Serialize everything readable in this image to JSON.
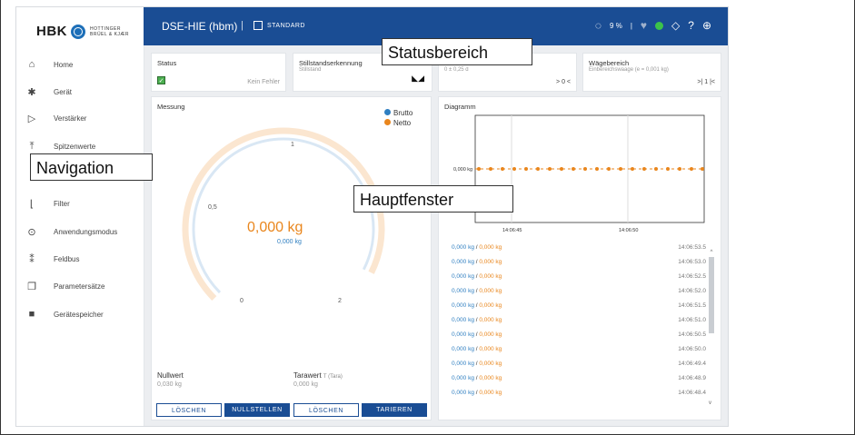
{
  "logo": {
    "brand": "HBK",
    "sub1": "HOTTINGER",
    "sub2": "BRÜEL & KJÆR"
  },
  "nav": [
    {
      "label": "Home",
      "icon": "home-icon"
    },
    {
      "label": "Gerät",
      "icon": "gear-icon"
    },
    {
      "label": "Verstärker",
      "icon": "amplifier-icon"
    },
    {
      "label": "Spitzenwerte",
      "icon": "peak-icon"
    },
    {
      "label": "Filter",
      "icon": "filter-icon"
    },
    {
      "label": "Anwendungsmodus",
      "icon": "mode-icon"
    },
    {
      "label": "Feldbus",
      "icon": "fieldbus-icon"
    },
    {
      "label": "Parametersätze",
      "icon": "parameter-sets-icon"
    },
    {
      "label": "Gerätespeicher",
      "icon": "folder-icon"
    }
  ],
  "topbar": {
    "title": "DSE-HIE (hbm)",
    "separator": "|",
    "mode": "STANDARD",
    "percent": "9 %",
    "separator2": "|"
  },
  "status_cards": {
    "status": {
      "title": "Status",
      "value": "Kein Fehler"
    },
    "still": {
      "title": "Stillstandserkennung",
      "sub": "Stillstand"
    },
    "zero": {
      "sub": "0 ± 0,25 d",
      "value": "> 0 <"
    },
    "range": {
      "title": "Wägebereich",
      "sub": "Einbereichswaage (e = 0,001 kg)",
      "value": ">| 1 |<"
    }
  },
  "measure": {
    "title": "Messung",
    "legend": [
      {
        "label": "Brutto",
        "color": "#2f7fc1"
      },
      {
        "label": "Netto",
        "color": "#e9861d"
      }
    ],
    "value_main": "0,000 kg",
    "value_sub": "0,000 kg",
    "gauge_fraction": 0.0,
    "ticks": {
      "t0": "0",
      "t05": "0,5",
      "t1": "1",
      "t2": "2"
    },
    "nullwert_label": "Nullwert",
    "nullwert_value": "0,030 kg",
    "tara_label": "Tarawert",
    "tara_hint": "T (Tara)",
    "tara_value": "0,000 kg",
    "buttons": [
      "LÖSCHEN",
      "NULLSTELLEN",
      "LÖSCHEN",
      "TARIEREN"
    ]
  },
  "diagram": {
    "title": "Diagramm",
    "ylabel": "0,000 kg",
    "xticks": [
      "14:06:45",
      "14:06:50"
    ]
  },
  "log": [
    {
      "b": "0,000 kg",
      "o": "0,000 kg",
      "t": "14:06:53.5"
    },
    {
      "b": "0,000 kg",
      "o": "0,000 kg",
      "t": "14:06:53.0"
    },
    {
      "b": "0,000 kg",
      "o": "0,000 kg",
      "t": "14:06:52.5"
    },
    {
      "b": "0,000 kg",
      "o": "0,000 kg",
      "t": "14:06:52.0"
    },
    {
      "b": "0,000 kg",
      "o": "0,000 kg",
      "t": "14:06:51.5"
    },
    {
      "b": "0,000 kg",
      "o": "0,000 kg",
      "t": "14:06:51.0"
    },
    {
      "b": "0,000 kg",
      "o": "0,000 kg",
      "t": "14:06:50.5"
    },
    {
      "b": "0,000 kg",
      "o": "0,000 kg",
      "t": "14:06:50.0"
    },
    {
      "b": "0,000 kg",
      "o": "0,000 kg",
      "t": "14:06:49.4"
    },
    {
      "b": "0,000 kg",
      "o": "0,000 kg",
      "t": "14:06:48.9"
    },
    {
      "b": "0,000 kg",
      "o": "0,000 kg",
      "t": "14:06:48.4"
    }
  ],
  "callouts": {
    "status": "Statusbereich",
    "nav": "Navigation",
    "main": "Hauptfenster"
  },
  "colors": {
    "accent": "#1a4d94",
    "brutto": "#2f7fc1",
    "netto": "#e9861d",
    "ok": "#3cc34a"
  }
}
